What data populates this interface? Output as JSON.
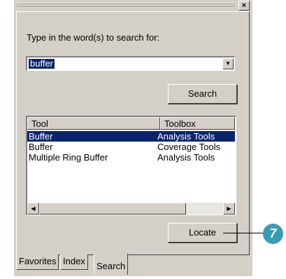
{
  "window": {
    "close_glyph": "×"
  },
  "search": {
    "prompt": "Type in the word(s) to search for:",
    "query_value": "buffer",
    "dropdown_icon": "▼",
    "search_label": "Search"
  },
  "results": {
    "columns": [
      "Tool",
      "Toolbox"
    ],
    "rows": [
      {
        "tool": "Buffer",
        "toolbox": "Analysis Tools",
        "selected": true
      },
      {
        "tool": "Buffer",
        "toolbox": "Coverage Tools",
        "selected": false
      },
      {
        "tool": "Multiple Ring Buffer",
        "toolbox": "Analysis Tools",
        "selected": false
      }
    ],
    "scroll_left_icon": "◀",
    "scroll_right_icon": "▶"
  },
  "actions": {
    "locate_label": "Locate"
  },
  "tabs": [
    {
      "label": "Favorites",
      "active": false
    },
    {
      "label": "Index",
      "active": false
    },
    {
      "label": "Search",
      "active": true
    }
  ],
  "callout": {
    "number": "7",
    "color": "#3a9bb4"
  }
}
